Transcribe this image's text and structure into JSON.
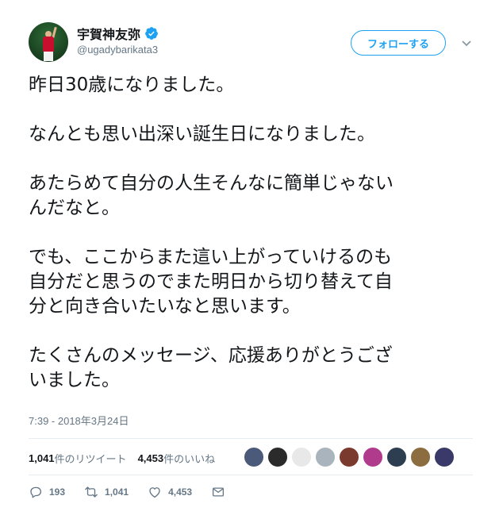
{
  "user": {
    "display_name": "宇賀神友弥",
    "handle": "@ugadybarikata3",
    "avatar_icon": "player-avatar",
    "verified_icon": "verified-badge-icon"
  },
  "follow_label": "フォローする",
  "tweet": {
    "lines": [
      "昨日30歳になりました。",
      "",
      "なんとも思い出深い誕生日になりました。",
      "",
      "あたらめて自分の人生そんなに簡単じゃない",
      "んだなと。",
      "",
      "でも、ここからまた這い上がっていけるのも",
      "自分だと思うのでまた明日から切り替えて自",
      "分と向き合いたいなと思います。",
      "",
      "たくさんのメッセージ、応援ありがとうござ",
      "いました。"
    ]
  },
  "timestamp": "7:39 - 2018年3月24日",
  "stats": {
    "retweets_count": "1,041",
    "retweets_label": "件のリツイート",
    "likes_count": "4,453",
    "likes_label": "件のいいね"
  },
  "likers": [
    {
      "color": "#4a5a78"
    },
    {
      "color": "#2b2b2b"
    },
    {
      "color": "#e8e8e8"
    },
    {
      "color": "#a9b4bd"
    },
    {
      "color": "#7a3b2e"
    },
    {
      "color": "#b03a8c"
    },
    {
      "color": "#2c3e50"
    },
    {
      "color": "#8b6d3f"
    },
    {
      "color": "#3a3a6a"
    }
  ],
  "actions": {
    "reply_count": "193",
    "retweet_count": "1,041",
    "like_count": "4,453"
  },
  "colors": {
    "accent": "#1da1f2",
    "text": "#14171a",
    "muted": "#657786"
  }
}
